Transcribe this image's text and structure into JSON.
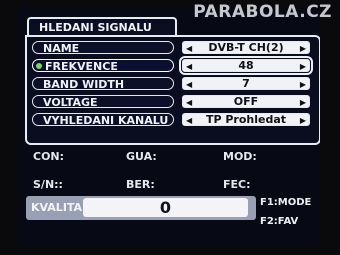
{
  "watermark": "PARABOLA.CZ",
  "screen_title": "HLEDANI SIGNALU",
  "settings": [
    {
      "label": "NAME",
      "value": "DVB-T CH(2)"
    },
    {
      "label": "FREKVENCE",
      "value": "48"
    },
    {
      "label": "BAND WIDTH",
      "value": "7"
    },
    {
      "label": "VOLTAGE",
      "value": "OFF"
    },
    {
      "label": "VYHLEDANI KANALU",
      "value": "TP Prohledat"
    }
  ],
  "status": {
    "con_label": "CON:",
    "gua_label": "GUA:",
    "mod_label": "MOD:",
    "sn_label": "S/N::",
    "ber_label": "BER:",
    "fec_label": "FEC:"
  },
  "quality": {
    "label": "KVALITA",
    "value": "0"
  },
  "function_keys": {
    "f1": "F1:MODE",
    "f2": "F2:FAV"
  },
  "colors": {
    "accent_dot": "#7fd45a",
    "background": "#070a14"
  },
  "icons": {
    "left_arrow": "triangle-left-icon",
    "right_arrow": "triangle-right-icon"
  }
}
